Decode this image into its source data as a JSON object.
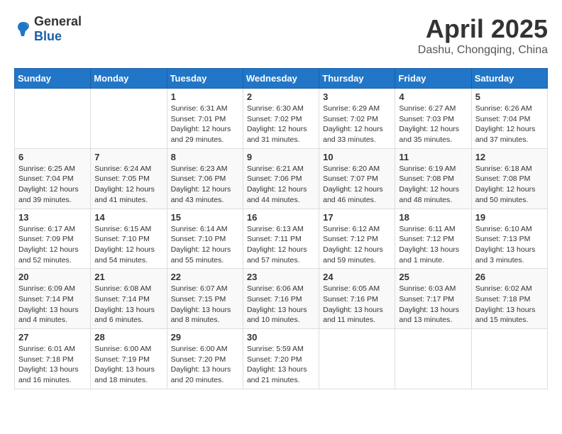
{
  "header": {
    "logo_general": "General",
    "logo_blue": "Blue",
    "month": "April 2025",
    "location": "Dashu, Chongqing, China"
  },
  "weekdays": [
    "Sunday",
    "Monday",
    "Tuesday",
    "Wednesday",
    "Thursday",
    "Friday",
    "Saturday"
  ],
  "weeks": [
    [
      {
        "day": "",
        "info": ""
      },
      {
        "day": "",
        "info": ""
      },
      {
        "day": "1",
        "info": "Sunrise: 6:31 AM\nSunset: 7:01 PM\nDaylight: 12 hours\nand 29 minutes."
      },
      {
        "day": "2",
        "info": "Sunrise: 6:30 AM\nSunset: 7:02 PM\nDaylight: 12 hours\nand 31 minutes."
      },
      {
        "day": "3",
        "info": "Sunrise: 6:29 AM\nSunset: 7:02 PM\nDaylight: 12 hours\nand 33 minutes."
      },
      {
        "day": "4",
        "info": "Sunrise: 6:27 AM\nSunset: 7:03 PM\nDaylight: 12 hours\nand 35 minutes."
      },
      {
        "day": "5",
        "info": "Sunrise: 6:26 AM\nSunset: 7:04 PM\nDaylight: 12 hours\nand 37 minutes."
      }
    ],
    [
      {
        "day": "6",
        "info": "Sunrise: 6:25 AM\nSunset: 7:04 PM\nDaylight: 12 hours\nand 39 minutes."
      },
      {
        "day": "7",
        "info": "Sunrise: 6:24 AM\nSunset: 7:05 PM\nDaylight: 12 hours\nand 41 minutes."
      },
      {
        "day": "8",
        "info": "Sunrise: 6:23 AM\nSunset: 7:06 PM\nDaylight: 12 hours\nand 43 minutes."
      },
      {
        "day": "9",
        "info": "Sunrise: 6:21 AM\nSunset: 7:06 PM\nDaylight: 12 hours\nand 44 minutes."
      },
      {
        "day": "10",
        "info": "Sunrise: 6:20 AM\nSunset: 7:07 PM\nDaylight: 12 hours\nand 46 minutes."
      },
      {
        "day": "11",
        "info": "Sunrise: 6:19 AM\nSunset: 7:08 PM\nDaylight: 12 hours\nand 48 minutes."
      },
      {
        "day": "12",
        "info": "Sunrise: 6:18 AM\nSunset: 7:08 PM\nDaylight: 12 hours\nand 50 minutes."
      }
    ],
    [
      {
        "day": "13",
        "info": "Sunrise: 6:17 AM\nSunset: 7:09 PM\nDaylight: 12 hours\nand 52 minutes."
      },
      {
        "day": "14",
        "info": "Sunrise: 6:15 AM\nSunset: 7:10 PM\nDaylight: 12 hours\nand 54 minutes."
      },
      {
        "day": "15",
        "info": "Sunrise: 6:14 AM\nSunset: 7:10 PM\nDaylight: 12 hours\nand 55 minutes."
      },
      {
        "day": "16",
        "info": "Sunrise: 6:13 AM\nSunset: 7:11 PM\nDaylight: 12 hours\nand 57 minutes."
      },
      {
        "day": "17",
        "info": "Sunrise: 6:12 AM\nSunset: 7:12 PM\nDaylight: 12 hours\nand 59 minutes."
      },
      {
        "day": "18",
        "info": "Sunrise: 6:11 AM\nSunset: 7:12 PM\nDaylight: 13 hours\nand 1 minute."
      },
      {
        "day": "19",
        "info": "Sunrise: 6:10 AM\nSunset: 7:13 PM\nDaylight: 13 hours\nand 3 minutes."
      }
    ],
    [
      {
        "day": "20",
        "info": "Sunrise: 6:09 AM\nSunset: 7:14 PM\nDaylight: 13 hours\nand 4 minutes."
      },
      {
        "day": "21",
        "info": "Sunrise: 6:08 AM\nSunset: 7:14 PM\nDaylight: 13 hours\nand 6 minutes."
      },
      {
        "day": "22",
        "info": "Sunrise: 6:07 AM\nSunset: 7:15 PM\nDaylight: 13 hours\nand 8 minutes."
      },
      {
        "day": "23",
        "info": "Sunrise: 6:06 AM\nSunset: 7:16 PM\nDaylight: 13 hours\nand 10 minutes."
      },
      {
        "day": "24",
        "info": "Sunrise: 6:05 AM\nSunset: 7:16 PM\nDaylight: 13 hours\nand 11 minutes."
      },
      {
        "day": "25",
        "info": "Sunrise: 6:03 AM\nSunset: 7:17 PM\nDaylight: 13 hours\nand 13 minutes."
      },
      {
        "day": "26",
        "info": "Sunrise: 6:02 AM\nSunset: 7:18 PM\nDaylight: 13 hours\nand 15 minutes."
      }
    ],
    [
      {
        "day": "27",
        "info": "Sunrise: 6:01 AM\nSunset: 7:18 PM\nDaylight: 13 hours\nand 16 minutes."
      },
      {
        "day": "28",
        "info": "Sunrise: 6:00 AM\nSunset: 7:19 PM\nDaylight: 13 hours\nand 18 minutes."
      },
      {
        "day": "29",
        "info": "Sunrise: 6:00 AM\nSunset: 7:20 PM\nDaylight: 13 hours\nand 20 minutes."
      },
      {
        "day": "30",
        "info": "Sunrise: 5:59 AM\nSunset: 7:20 PM\nDaylight: 13 hours\nand 21 minutes."
      },
      {
        "day": "",
        "info": ""
      },
      {
        "day": "",
        "info": ""
      },
      {
        "day": "",
        "info": ""
      }
    ]
  ]
}
